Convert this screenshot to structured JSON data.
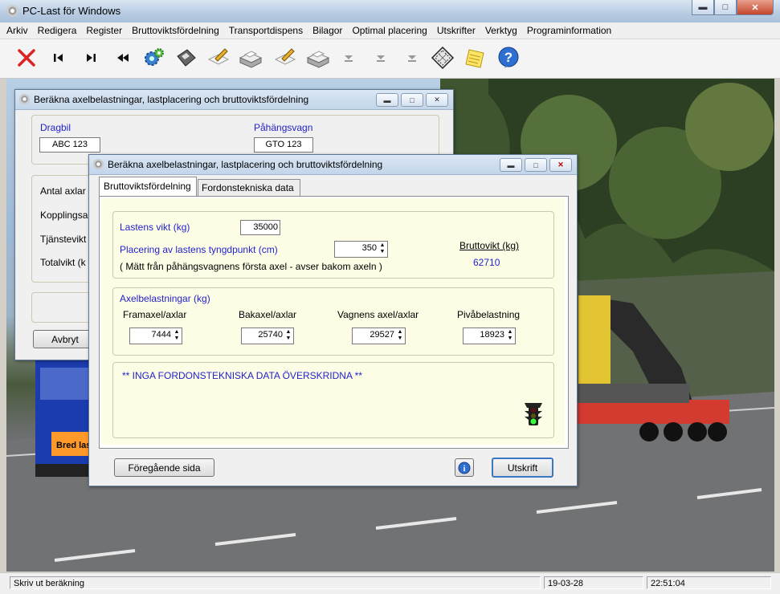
{
  "window": {
    "title": "PC-Last för Windows"
  },
  "menu": [
    "Arkiv",
    "Redigera",
    "Register",
    "Bruttoviktsfördelning",
    "Transportdispens",
    "Bilagor",
    "Optimal placering",
    "Utskrifter",
    "Verktyg",
    "Programinformation"
  ],
  "toolbar": [
    "close-x-icon",
    "first-record-icon",
    "last-record-icon",
    "rewind-icon",
    "gears-icon",
    "floppy-disk-icon",
    "edit-pencil-icon",
    "printer-icon",
    "edit-pencil-icon",
    "printer-icon",
    "down-arrow-icon",
    "down-arrow-icon",
    "down-arrow-icon",
    "calculator-icon",
    "notepad-icon",
    "help-icon"
  ],
  "back_dialog": {
    "title": "Beräkna axelbelastningar, lastplacering och bruttoviktsfördelning",
    "dragbil_label": "Dragbil",
    "dragbil_value": "ABC 123",
    "pahangsvagn_label": "Påhängsvagn",
    "pahangsvagn_value": "GTO 123",
    "rows": [
      "Antal axlar",
      "Kopplingsa",
      "Tjänstevikt",
      "Totalvikt (k"
    ],
    "cancel_label": "Avbryt"
  },
  "front_dialog": {
    "title": "Beräkna axelbelastningar, lastplacering och bruttoviktsfördelning",
    "tabs": [
      "Bruttoviktsfördelning",
      "Fordonstekniska data"
    ],
    "load_weight_label": "Lastens vikt (kg)",
    "load_weight_value": "35000",
    "cog_label": "Placering av lastens tyngdpunkt (cm)",
    "cog_value": "350",
    "cog_note": "( Mätt från påhängsvagnens första axel   - avser bakom axeln )",
    "gross_weight_label": "Bruttovikt (kg)",
    "gross_weight_value": "62710",
    "axle_group_title": "Axelbelastningar (kg)",
    "axles": [
      {
        "label": "Framaxel/axlar",
        "value": "7444"
      },
      {
        "label": "Bakaxel/axlar",
        "value": "25740"
      },
      {
        "label": "Vagnens axel/axlar",
        "value": "29527"
      },
      {
        "label": "Pivåbelastning",
        "value": "18923"
      }
    ],
    "message": "** INGA FORDONSTEKNISKA DATA ÖVERSKRIDNA **",
    "prev_button": "Föregående sida",
    "print_button": "Utskrift"
  },
  "status": {
    "text": "Skriv ut beräkning",
    "date": "19-03-28",
    "time": "22:51:04"
  },
  "colors": {
    "accent_blue": "#2222cc",
    "panel_yellow": "#fdfde6"
  }
}
